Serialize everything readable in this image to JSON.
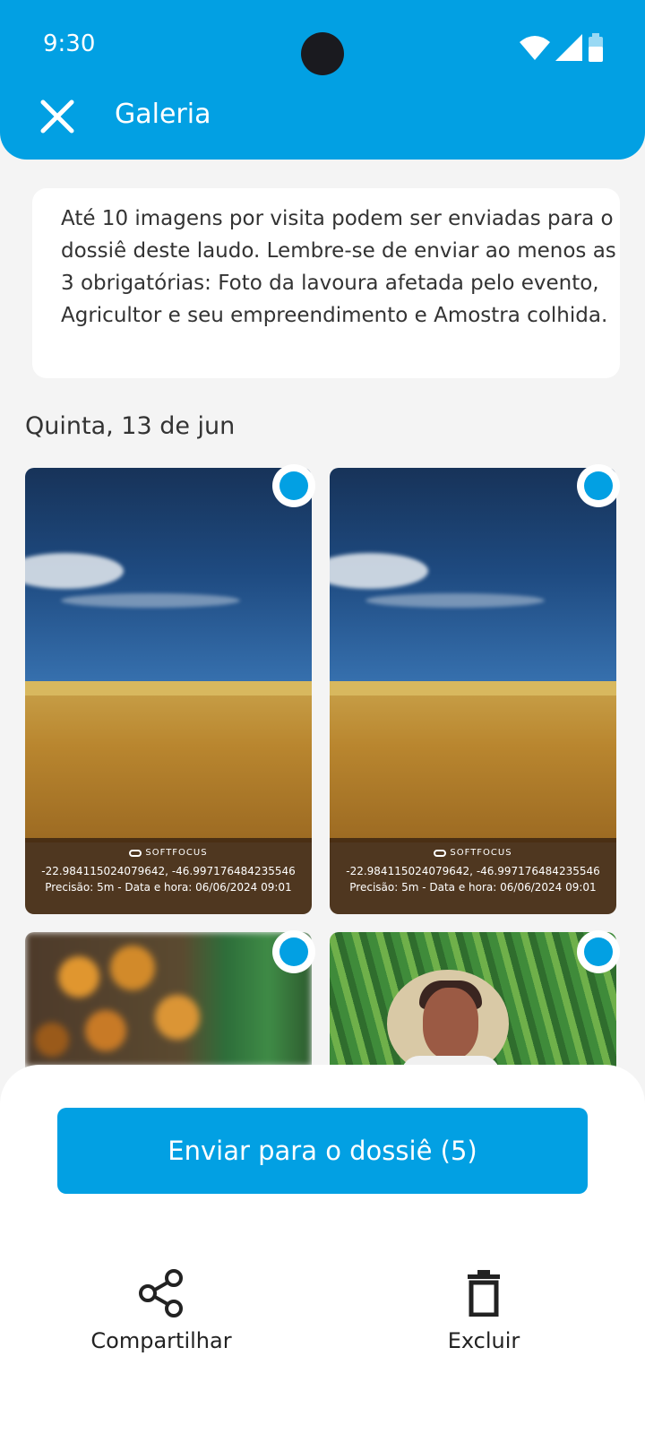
{
  "status_bar": {
    "time": "9:30"
  },
  "header": {
    "title": "Galeria",
    "close_icon": "close-icon"
  },
  "info_text": "Até 10 imagens por visita podem ser enviadas para o dossiê deste laudo. Lembre-se de enviar ao menos as 3 obrigatórias: Foto da lavoura afetada pelo evento, Agricultor e seu empreendimento e Amostra colhida.",
  "section_date": "Quinta, 13 de jun",
  "photos": [
    {
      "brand": "SOFTFOCUS",
      "coords": "-22.984115024079642, -46.997176484235546",
      "meta": "Precisão: 5m - Data e hora: 06/06/2024 09:01",
      "selected": true
    },
    {
      "brand": "SOFTFOCUS",
      "coords": "-22.984115024079642, -46.997176484235546",
      "meta": "Precisão: 5m - Data e hora: 06/06/2024 09:01",
      "selected": true
    },
    {
      "selected": true
    },
    {
      "selected": true
    }
  ],
  "bottom": {
    "send_label": "Enviar para o dossiê (5)",
    "share_label": "Compartilhar",
    "delete_label": "Excluir"
  },
  "colors": {
    "primary": "#02a0e3",
    "background": "#f4f4f4"
  }
}
